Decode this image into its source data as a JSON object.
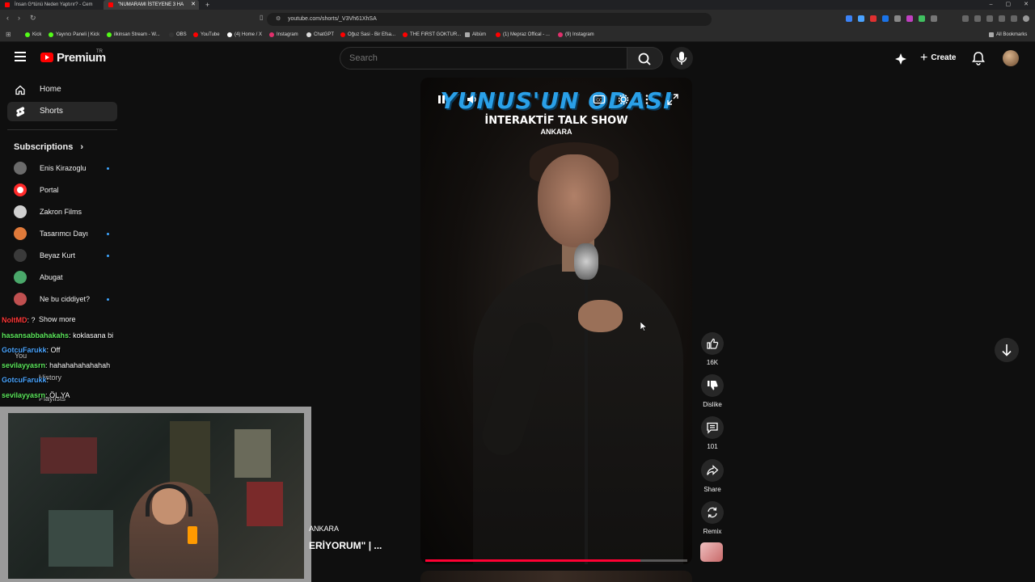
{
  "browser": {
    "tabs": [
      {
        "label": "İnsan G*tünü Neden Yaptırır? - Cem",
        "active": false
      },
      {
        "label": "\"NUMARAMI İSTEYENE 3 HA",
        "active": true
      }
    ],
    "new_tab": "+",
    "window_controls": [
      "–",
      "▢",
      "✕"
    ],
    "url": "youtube.com/shorts/_V3Vh61XhSA",
    "bookmarks": [
      {
        "label": "Kick",
        "color": "#53fc18"
      },
      {
        "label": "Yayıncı Paneli | Kick",
        "color": "#53fc18"
      },
      {
        "label": "ilkinsan Stream - W...",
        "color": "#53fc18"
      },
      {
        "label": "OBS",
        "color": "#333333"
      },
      {
        "label": "YouTube",
        "color": "#ff0000"
      },
      {
        "label": "(4) Home / X",
        "color": "#ffffff"
      },
      {
        "label": "Instagram",
        "color": "#e1306c"
      },
      {
        "label": "ChatGPT",
        "color": "#dddddd"
      },
      {
        "label": "Oğuz Sasi - Bir Efsa...",
        "color": "#ff0000"
      },
      {
        "label": "THE FIRST GOKTUR...",
        "color": "#ff0000"
      },
      {
        "label": "Albüm",
        "color": "#aaaaaa"
      },
      {
        "label": "(1) Mepraz Offical - ...",
        "color": "#ff0000"
      },
      {
        "label": "(9) Instagram",
        "color": "#e1306c"
      }
    ],
    "all_bookmarks": "All Bookmarks"
  },
  "header": {
    "brand": "Premium",
    "brand_region": "TR",
    "search_placeholder": "Search",
    "create_label": "Create"
  },
  "sidebar": {
    "items": [
      {
        "label": "Home",
        "active": false
      },
      {
        "label": "Shorts",
        "active": true
      }
    ],
    "subscriptions_title": "Subscriptions",
    "subscriptions": [
      {
        "name": "Enis Kirazoglu",
        "color": "#6b6b6b",
        "live": true
      },
      {
        "name": "Portal",
        "color": "#ff2a2a",
        "live": false
      },
      {
        "name": "Zakron Films",
        "color": "#d0d0d0",
        "live": false
      },
      {
        "name": "Tasarımcı Dayı",
        "color": "#e07a3a",
        "live": true
      },
      {
        "name": "Beyaz Kurt",
        "color": "#3a3a3a",
        "live": true
      },
      {
        "name": "Abugat",
        "color": "#4aa86a",
        "live": false
      },
      {
        "name": "Ne bu ciddiyet?",
        "color": "#c05050",
        "live": true
      }
    ],
    "show_more": "Show more",
    "you_label": "You",
    "history_label": "History",
    "playlists_label": "Playlists"
  },
  "chat": [
    {
      "user": "NoItMD",
      "color": "#ff3a3a",
      "message": "?"
    },
    {
      "user": "hasansabbahakahs",
      "color": "#5ee85e",
      "message": "koklasana bi"
    },
    {
      "user": "GotcuFarukk",
      "color": "#4da6ff",
      "message": "Off"
    },
    {
      "user": "sevilayyasrn",
      "color": "#5ee85e",
      "message": "hahahahahahahah"
    },
    {
      "user": "GotcuFarukk",
      "color": "#4da6ff",
      "message": ""
    },
    {
      "user": "sevilayyasrn",
      "color": "#5ee85e",
      "message": "ÖL YA"
    }
  ],
  "video": {
    "show_title": "YUNUS'UN ODASI",
    "show_subtitle": "İNTERAKTİF TALK SHOW",
    "show_city": "ANKARA",
    "progress_fraction": 0.82,
    "caption_city": "ANKARA",
    "caption_title": "ERİYORUM\" | ..."
  },
  "actions": [
    {
      "name": "like",
      "label": "16K"
    },
    {
      "name": "dislike",
      "label": "Dislike"
    },
    {
      "name": "comments",
      "label": "101"
    },
    {
      "name": "share",
      "label": "Share"
    },
    {
      "name": "remix",
      "label": "Remix"
    }
  ]
}
